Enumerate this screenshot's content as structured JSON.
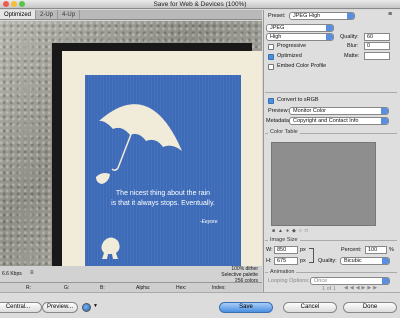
{
  "window": {
    "title": "Save for Web & Devices (100%)"
  },
  "tabs": [
    "Optimized",
    "2-Up",
    "4-Up"
  ],
  "artwork": {
    "quote_line1": "The nicest thing about the rain",
    "quote_line2": "is that it always stops. Eventually.",
    "attribution": "-Eeyore"
  },
  "info": {
    "left": "6.6 Kbps",
    "dither": "100% dither",
    "palette": "Selective palette",
    "colors": "256 colors"
  },
  "statusbar": [
    "R:",
    "G:",
    "B:",
    "Alpha:",
    "Hex:",
    "Index:"
  ],
  "settings": {
    "preset_label": "Preset:",
    "preset_value": "JPEG High",
    "format": "JPEG",
    "quality_preset": "High",
    "quality_label": "Quality:",
    "quality_value": "60",
    "progressive": "Progressive",
    "blur_label": "Blur:",
    "blur_value": "0",
    "optimized": "Optimized",
    "matte_label": "Matte:",
    "embed": "Embed Color Profile",
    "convert": "Convert to sRGB",
    "preview_label": "Preview:",
    "preview_value": "Monitor Color",
    "metadata_label": "Metadata:",
    "metadata_value": "Copyright and Contact Info",
    "color_table": "Color Table"
  },
  "image_size": {
    "title": "Image Size",
    "w_label": "W:",
    "w_value": "850",
    "h_label": "H:",
    "h_value": "675",
    "unit": "px",
    "percent_label": "Percent:",
    "percent_value": "100",
    "percent_unit": "%",
    "quality_label": "Quality:",
    "quality_value": "Bicubic"
  },
  "animation": {
    "title": "Animation",
    "looping_label": "Looping Options:",
    "looping_value": "Once",
    "frame_count": "1 of 1"
  },
  "buttons": {
    "device_central": "Central...",
    "preview": "Preview...",
    "save": "Save",
    "cancel": "Cancel",
    "done": "Done"
  },
  "colors": {
    "accent": "#4a8fe0",
    "poster_blue": "#3d6bb8"
  }
}
